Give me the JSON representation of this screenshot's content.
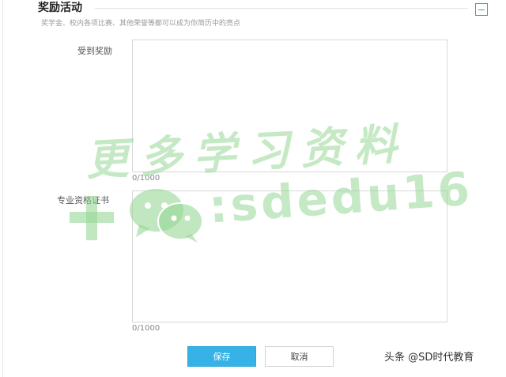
{
  "section": {
    "title": "奖励活动",
    "description": "奖学金、校内各项比赛、其他荣誉等都可以成为你简历中的亮点"
  },
  "fields": {
    "awards": {
      "label": "受到奖励",
      "value": "",
      "counter": "0/1000"
    },
    "certificates": {
      "label": "专业资格证书",
      "value": "",
      "counter": "0/1000"
    }
  },
  "buttons": {
    "save_label": "保存",
    "cancel_label": "取消"
  },
  "watermark": {
    "line1": "更多学习资料",
    "line2": ":sdedu16"
  },
  "credit": "头条 @SD时代教育",
  "colors": {
    "accent": "#36b2e6",
    "watermark": "#96d796"
  },
  "icons": {
    "collapse": "minus-square-icon",
    "plus": "plus-icon",
    "wechat": "wechat-icon"
  }
}
